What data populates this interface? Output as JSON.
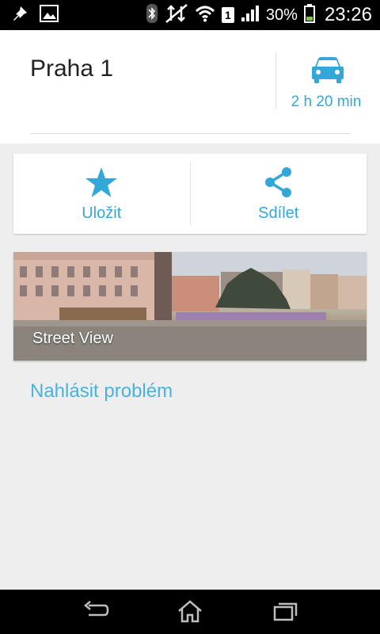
{
  "status_bar": {
    "battery_percent": "30%",
    "time": "23:26",
    "sim_slot": "1",
    "icons": [
      "notification-pin-icon",
      "gallery-icon",
      "bluetooth-icon",
      "data-off-icon",
      "wifi-icon",
      "sim-icon",
      "signal-icon",
      "battery-icon"
    ]
  },
  "place": {
    "title": "Praha 1",
    "travel_time": "2 h 20 min",
    "travel_mode_icon": "car-icon"
  },
  "actions": {
    "save_label": "Uložit",
    "share_label": "Sdílet"
  },
  "street_view": {
    "label": "Street View"
  },
  "report": {
    "label": "Nahlásit problém"
  },
  "nav_bar": {
    "icons": [
      "back-icon",
      "home-icon",
      "recents-icon"
    ]
  },
  "colors": {
    "accent": "#33a8d8",
    "background": "#eeeeee",
    "card": "#ffffff",
    "bars": "#000000"
  }
}
